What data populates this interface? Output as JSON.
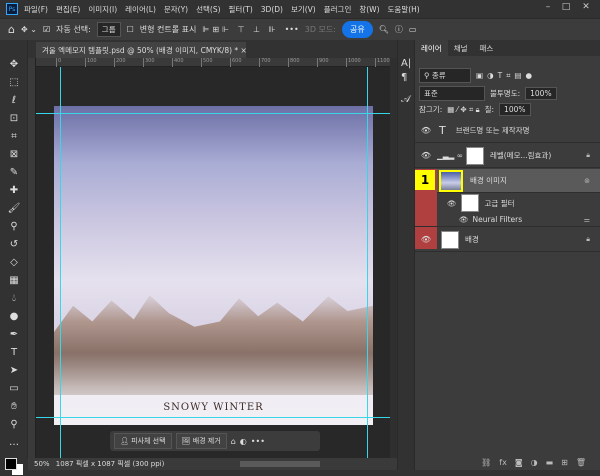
{
  "app": {
    "logo": "Ps",
    "menu": [
      "파일(F)",
      "편집(E)",
      "이미지(I)",
      "레이어(L)",
      "문자(Y)",
      "선택(S)",
      "필터(T)",
      "3D(D)",
      "보기(V)",
      "플러그인",
      "창(W)",
      "도움말(H)"
    ]
  },
  "options": {
    "auto_select_label": "자동 선택:",
    "auto_select_value": "그룹",
    "transform_label": "변형 컨트롤 표시",
    "mode_3d": "3D 모드:",
    "share": "공유",
    "more": "•••"
  },
  "document": {
    "tab_title": "겨울 엑메모지 템플릿.psd @ 50% (배경 이미지, CMYK/8) *",
    "ruler_ticks": [
      "0",
      "100",
      "200",
      "300",
      "400",
      "500",
      "600",
      "700",
      "800",
      "900",
      "1000",
      "1100"
    ],
    "artwork_text": "SNOWY WINTER"
  },
  "context_bar": {
    "select_subject": "피사체 선택",
    "remove_bg": "배경 제거"
  },
  "status": {
    "zoom": "50%",
    "size": "1087 픽셀 x 1087 픽셀 (300 ppi)"
  },
  "layers_panel": {
    "tabs": [
      "레이어",
      "채널",
      "패스"
    ],
    "filter": "종류",
    "blend_mode": "표준",
    "opacity_label": "불투명도:",
    "opacity": "100%",
    "lock_label": "잠그기:",
    "fill_label": "칠:",
    "fill": "100%",
    "layers": [
      {
        "name": "브랜드명 또는 제작자명",
        "type": "text"
      },
      {
        "name": "레벨(메모...림효과)",
        "type": "adjustment"
      },
      {
        "name": "배경 이미지",
        "type": "smart",
        "selected": true,
        "badge": "1"
      },
      {
        "name": "고급 필터",
        "type": "filter"
      },
      {
        "name": "Neural Filters",
        "type": "filter-item"
      },
      {
        "name": "배경",
        "type": "background"
      }
    ]
  },
  "colors": {
    "accent": "#1473e6",
    "guide": "#38d6e6",
    "highlight": "#ffff00",
    "layer_color_tag": "#b04040"
  }
}
